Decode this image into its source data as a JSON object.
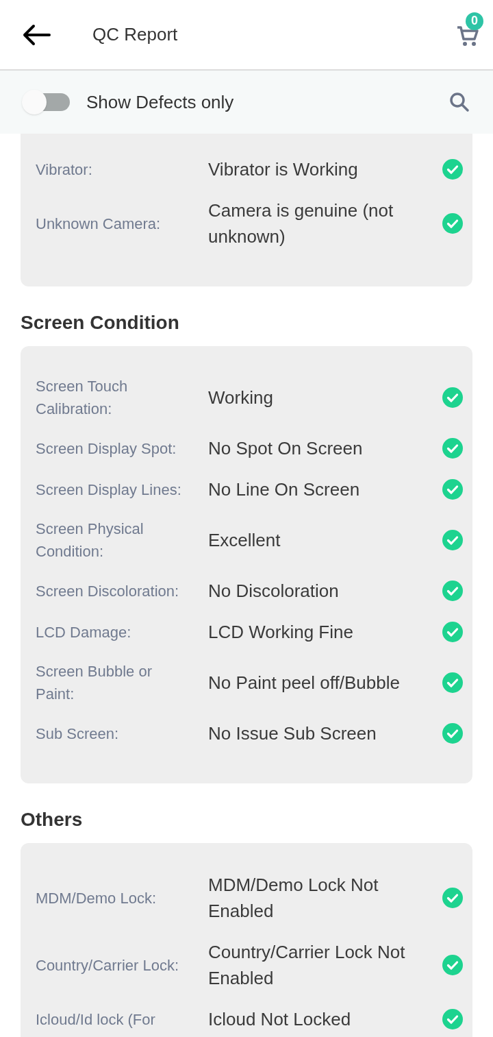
{
  "header": {
    "title": "QC Report",
    "cart_count": "0"
  },
  "filter": {
    "label": "Show Defects only",
    "on": false
  },
  "sections": [
    {
      "rows": [
        {
          "label": "Vibrator:",
          "value": "Vibrator is Working",
          "passed": true
        },
        {
          "label": "Unknown Camera:",
          "value": "Camera is genuine (not unknown)",
          "passed": true
        }
      ]
    },
    {
      "title": "Screen Condition",
      "rows": [
        {
          "label": "Screen Touch Calibration:",
          "value": "Working",
          "passed": true
        },
        {
          "label": "Screen Display Spot:",
          "value": "No Spot On Screen",
          "passed": true
        },
        {
          "label": "Screen Display Lines:",
          "value": "No Line On Screen",
          "passed": true
        },
        {
          "label": "Screen Physical Condition:",
          "value": "Excellent",
          "passed": true
        },
        {
          "label": "Screen Discoloration:",
          "value": "No Discoloration",
          "passed": true
        },
        {
          "label": "LCD Damage:",
          "value": "LCD Working Fine",
          "passed": true
        },
        {
          "label": "Screen Bubble or Paint:",
          "value": "No Paint peel off/Bubble",
          "passed": true
        },
        {
          "label": "Sub Screen:",
          "value": "No Issue Sub Screen",
          "passed": true
        }
      ]
    },
    {
      "title": "Others",
      "rows": [
        {
          "label": "MDM/Demo Lock:",
          "value": "MDM/Demo Lock Not Enabled",
          "passed": true
        },
        {
          "label": "Country/Carrier Lock:",
          "value": "Country/Carrier Lock Not Enabled",
          "passed": true
        },
        {
          "label": "Icloud/Id lock (For",
          "value": "Icloud Not Locked",
          "passed": true
        }
      ]
    }
  ]
}
